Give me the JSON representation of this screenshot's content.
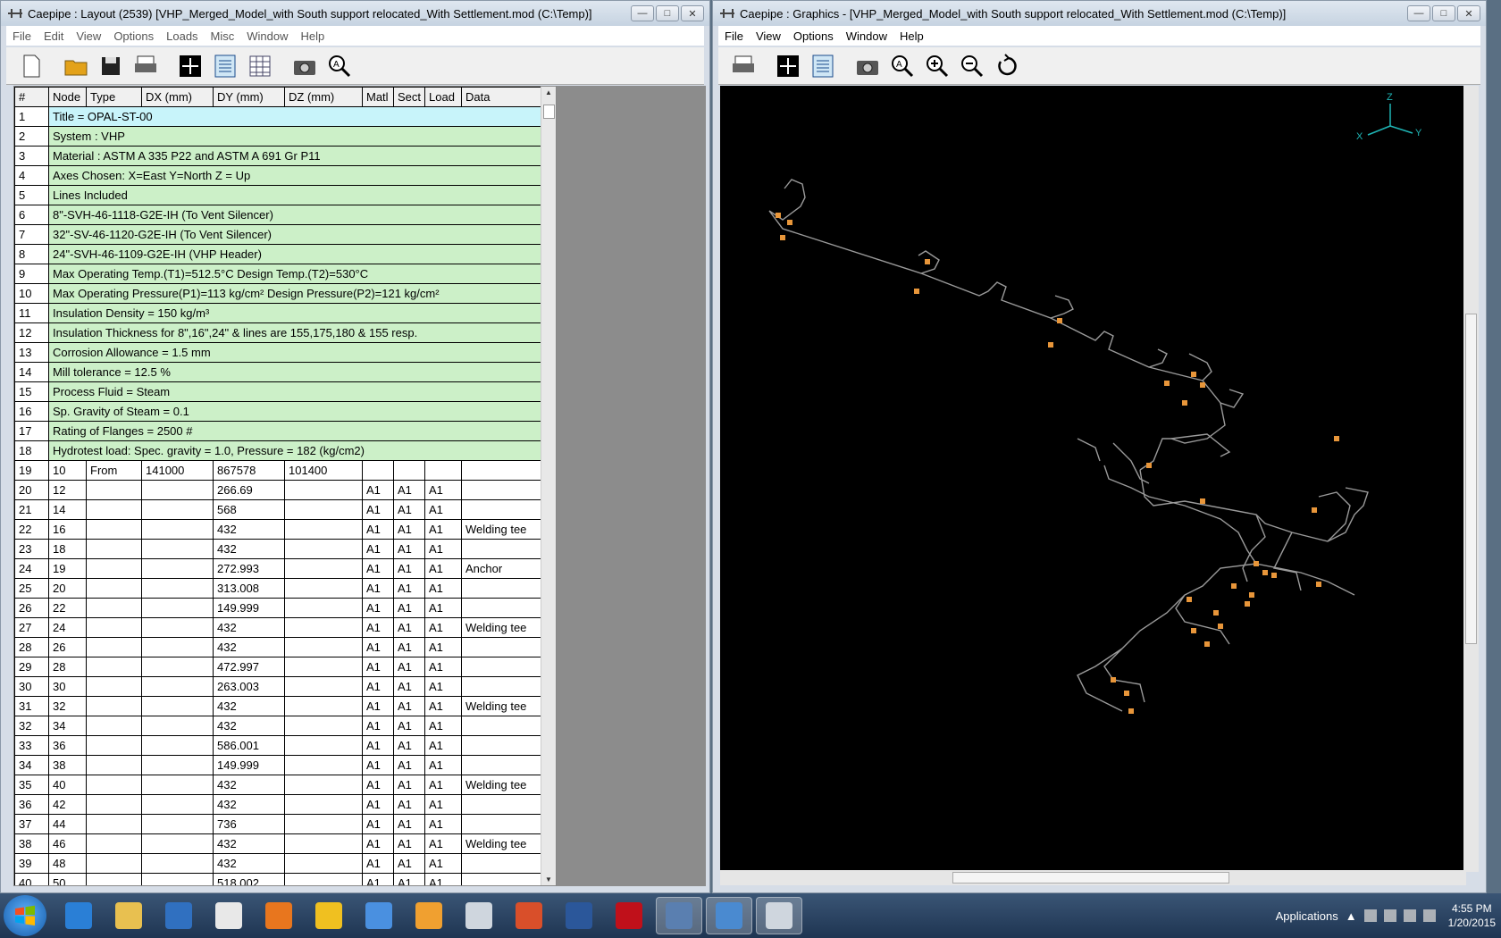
{
  "layout_window": {
    "title": "Caepipe : Layout  (2539)   [VHP_Merged_Model_with South support relocated_With Settlement.mod (C:\\Temp)]",
    "menu": [
      "File",
      "Edit",
      "View",
      "Options",
      "Loads",
      "Misc",
      "Window",
      "Help"
    ],
    "toolbar": [
      "new-file-icon",
      "open-folder-icon",
      "save-icon",
      "print-icon",
      "crosshair-icon",
      "text-list-icon",
      "table-icon",
      "camera-icon",
      "zoom-all-icon"
    ],
    "columns": [
      "#",
      "Node",
      "Type",
      "DX (mm)",
      "DY (mm)",
      "DZ (mm)",
      "Matl",
      "Sect",
      "Load",
      "Data"
    ],
    "header_rows": [
      {
        "n": "1",
        "text": "Title = OPAL-ST-00"
      },
      {
        "n": "2",
        "text": "System : VHP"
      },
      {
        "n": "3",
        "text": "Material : ASTM A 335 P22 and ASTM A 691 Gr P11"
      },
      {
        "n": "4",
        "text": "Axes Chosen: X=East Y=North Z = Up"
      },
      {
        "n": "5",
        "text": "Lines Included"
      },
      {
        "n": "6",
        "text": "8\"-SVH-46-1118-G2E-IH (To Vent Silencer)"
      },
      {
        "n": "7",
        "text": "32\"-SV-46-1120-G2E-IH (To Vent Silencer)"
      },
      {
        "n": "8",
        "text": "24\"-SVH-46-1109-G2E-IH (VHP Header)"
      },
      {
        "n": "9",
        "text": "Max Operating Temp.(T1)=512.5°C Design Temp.(T2)=530°C"
      },
      {
        "n": "10",
        "text": "Max Operating Pressure(P1)=113 kg/cm² Design Pressure(P2)=121 kg/cm²"
      },
      {
        "n": "11",
        "text": "Insulation Density = 150 kg/m³"
      },
      {
        "n": "12",
        "text": "Insulation Thickness for 8\",16\",24\" & lines are 155,175,180 & 155 resp."
      },
      {
        "n": "13",
        "text": "Corrosion Allowance = 1.5 mm"
      },
      {
        "n": "14",
        "text": "Mill tolerance = 12.5 %"
      },
      {
        "n": "15",
        "text": "Process Fluid = Steam"
      },
      {
        "n": "16",
        "text": "Sp. Gravity of Steam = 0.1"
      },
      {
        "n": "17",
        "text": "Rating of Flanges = 2500 #"
      },
      {
        "n": "18",
        "text": "Hydrotest load: Spec. gravity = 1.0,  Pressure =  182 (kg/cm2)"
      }
    ],
    "data_rows": [
      [
        "19",
        "10",
        "From",
        "141000",
        "867578",
        "101400",
        "",
        "",
        "",
        ""
      ],
      [
        "20",
        "12",
        "",
        "",
        "266.69",
        "",
        "A1",
        "A1",
        "A1",
        ""
      ],
      [
        "21",
        "14",
        "",
        "",
        "568",
        "",
        "A1",
        "A1",
        "A1",
        ""
      ],
      [
        "22",
        "16",
        "",
        "",
        "432",
        "",
        "A1",
        "A1",
        "A1",
        "Welding tee"
      ],
      [
        "23",
        "18",
        "",
        "",
        "432",
        "",
        "A1",
        "A1",
        "A1",
        ""
      ],
      [
        "24",
        "19",
        "",
        "",
        "272.993",
        "",
        "A1",
        "A1",
        "A1",
        "Anchor"
      ],
      [
        "25",
        "20",
        "",
        "",
        "313.008",
        "",
        "A1",
        "A1",
        "A1",
        ""
      ],
      [
        "26",
        "22",
        "",
        "",
        "149.999",
        "",
        "A1",
        "A1",
        "A1",
        ""
      ],
      [
        "27",
        "24",
        "",
        "",
        "432",
        "",
        "A1",
        "A1",
        "A1",
        "Welding tee"
      ],
      [
        "28",
        "26",
        "",
        "",
        "432",
        "",
        "A1",
        "A1",
        "A1",
        ""
      ],
      [
        "29",
        "28",
        "",
        "",
        "472.997",
        "",
        "A1",
        "A1",
        "A1",
        ""
      ],
      [
        "30",
        "30",
        "",
        "",
        "263.003",
        "",
        "A1",
        "A1",
        "A1",
        ""
      ],
      [
        "31",
        "32",
        "",
        "",
        "432",
        "",
        "A1",
        "A1",
        "A1",
        "Welding tee"
      ],
      [
        "32",
        "34",
        "",
        "",
        "432",
        "",
        "A1",
        "A1",
        "A1",
        ""
      ],
      [
        "33",
        "36",
        "",
        "",
        "586.001",
        "",
        "A1",
        "A1",
        "A1",
        ""
      ],
      [
        "34",
        "38",
        "",
        "",
        "149.999",
        "",
        "A1",
        "A1",
        "A1",
        ""
      ],
      [
        "35",
        "40",
        "",
        "",
        "432",
        "",
        "A1",
        "A1",
        "A1",
        "Welding tee"
      ],
      [
        "36",
        "42",
        "",
        "",
        "432",
        "",
        "A1",
        "A1",
        "A1",
        ""
      ],
      [
        "37",
        "44",
        "",
        "",
        "736",
        "",
        "A1",
        "A1",
        "A1",
        ""
      ],
      [
        "38",
        "46",
        "",
        "",
        "432",
        "",
        "A1",
        "A1",
        "A1",
        "Welding tee"
      ],
      [
        "39",
        "48",
        "",
        "",
        "432",
        "",
        "A1",
        "A1",
        "A1",
        ""
      ],
      [
        "40",
        "50",
        "",
        "",
        "518.002",
        "",
        "A1",
        "A1",
        "A1",
        ""
      ]
    ]
  },
  "graphics_window": {
    "title": "Caepipe : Graphics -  [VHP_Merged_Model_with South support relocated_With Settlement.mod (C:\\Temp)]",
    "menu": [
      "File",
      "View",
      "Options",
      "Window",
      "Help"
    ],
    "toolbar": [
      "print-icon",
      "crosshair-icon",
      "text-list-icon",
      "camera-icon",
      "zoom-all-icon",
      "zoom-in-icon",
      "zoom-out-icon",
      "rotate-icon"
    ],
    "axes": {
      "z": "Z",
      "x": "X",
      "y": "Y"
    },
    "colors": {
      "pipe": "#9a9a9a",
      "support": "#e8963a",
      "axis": "#1fb5b5"
    }
  },
  "taskbar": {
    "apps": [
      "ie-icon",
      "explorer-icon",
      "media-player-icon",
      "notepad-icon",
      "firefox-icon",
      "winamp-icon",
      "safari-icon",
      "outlook-icon",
      "caepipe-icon",
      "paint-icon",
      "word-icon",
      "acrobat-icon",
      "cmd-icon",
      "autocad-icon",
      "caepipe-active-icon"
    ],
    "tray_label": "Applications",
    "time": "4:55 PM",
    "date": "1/20/2015"
  }
}
